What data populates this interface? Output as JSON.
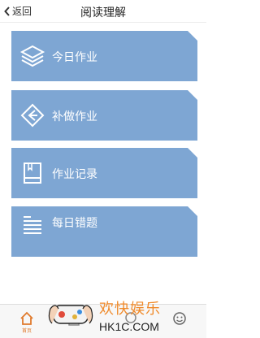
{
  "header": {
    "back_label": "返回",
    "title": "阅读理解"
  },
  "cards": [
    {
      "label": "今日作业",
      "icon": "layers-icon"
    },
    {
      "label": "补做作业",
      "icon": "diamond-arrow-icon"
    },
    {
      "label": "作业记录",
      "icon": "book-icon"
    },
    {
      "label": "每日错题",
      "icon": "list-icon"
    }
  ],
  "tabbar": {
    "tabs": [
      {
        "label": "首页",
        "icon": "home-icon",
        "active": true
      },
      {
        "label": "",
        "icon": "document-icon",
        "active": false
      },
      {
        "label": "",
        "icon": "chat-icon",
        "active": false
      },
      {
        "label": "",
        "icon": "smiley-icon",
        "active": false
      }
    ]
  },
  "watermark": {
    "text_cn": "欢快娱乐",
    "text_en": "HK1C.COM"
  },
  "colors": {
    "card": "#7ea6d3",
    "accent": "#e07a2c"
  }
}
